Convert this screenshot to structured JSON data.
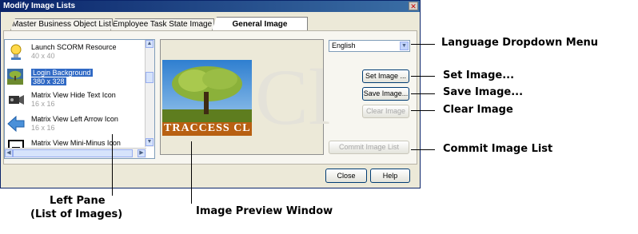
{
  "dialog": {
    "title": "Modify Image Lists",
    "close_glyph": "✕"
  },
  "tabs": [
    {
      "label": "Master Business Object List"
    },
    {
      "label": "Employee Task State Image List"
    },
    {
      "label": "General Image Resources"
    }
  ],
  "list": {
    "items": [
      {
        "name": "Launch SCORM Resource",
        "dim": "40 x 40",
        "icon": "lightbulb-icon"
      },
      {
        "name": "Login Background",
        "dim": "380 x 328",
        "icon": "tree-thumbnail-icon",
        "selected": true
      },
      {
        "name": "Matrix View Hide Text Icon",
        "dim": "16 x 16",
        "icon": "camera-icon"
      },
      {
        "name": "Matrix View Left Arrow Icon",
        "dim": "16 x 16",
        "icon": "left-arrow-icon"
      },
      {
        "name": "Matrix View Mini-Minus Icon",
        "dim": "",
        "icon": "minus-icon"
      }
    ]
  },
  "preview": {
    "banner_text": "TRACCESS CL",
    "background_letter": "Cl"
  },
  "language_select": {
    "value": "English"
  },
  "buttons": {
    "set_image": "Set Image ...",
    "save_image": "Save Image...",
    "clear_image": "Clear Image",
    "commit": "Commit Image List",
    "close": "Close",
    "help": "Help"
  },
  "callouts": {
    "language": "Language Dropdown Menu",
    "set_image": "Set Image...",
    "save_image": "Save Image...",
    "clear_image": "Clear Image",
    "commit": "Commit Image List",
    "left_pane_line1": "Left Pane",
    "left_pane_line2": "(List of Images)",
    "preview": "Image Preview Window"
  },
  "colors": {
    "title_bar": "#0a246a",
    "selection": "#316ac5"
  }
}
